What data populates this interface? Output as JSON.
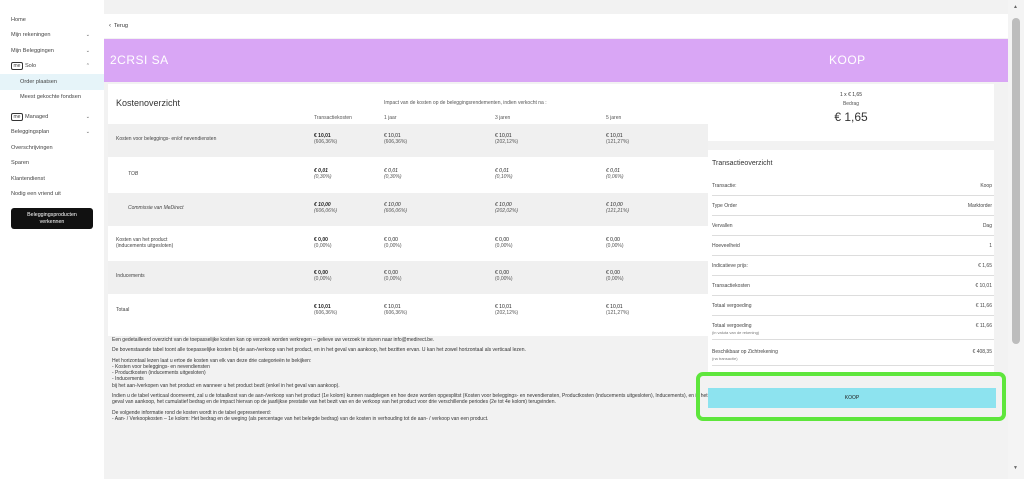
{
  "sidebar": {
    "items": [
      {
        "label": "Home",
        "chevron": ""
      },
      {
        "label": "Mijn rekeningen",
        "chevron": "⌄"
      },
      {
        "label": "Mijn Beleggingen",
        "chevron": "⌄"
      },
      {
        "tag": "me",
        "label": "Solo",
        "chevron": "⌃"
      },
      {
        "label": "Order plaatsen",
        "sub": true,
        "active": true
      },
      {
        "label": "Meest gekochte fondsen",
        "sub": true
      },
      {
        "tag": "me",
        "label": "Managed",
        "chevron": "⌄"
      },
      {
        "label": "Beleggingsplan",
        "chevron": "⌄"
      },
      {
        "label": "Overschrijvingen",
        "chevron": ""
      },
      {
        "label": "Sparen",
        "chevron": ""
      },
      {
        "label": "Klantendienst",
        "chevron": ""
      },
      {
        "label": "Nodig een vriend uit",
        "chevron": ""
      }
    ],
    "cta_line1": "Beleggingsproducten",
    "cta_line2": "verkennen"
  },
  "back_label": "Terug",
  "header": {
    "product_name": "2CRSI SA",
    "action_title": "KOOP",
    "band_color": "#d9a6f5"
  },
  "cost_overview": {
    "title": "Kostenoverzicht",
    "impact_note": "Impact van de kosten op de beleggingsrendementen, indien verkocht na :",
    "columns": [
      "Transactiekosten",
      "1 jaar",
      "3 jaren",
      "5 jaren"
    ],
    "rows": [
      {
        "label": "Kosten voor beleggings- en/of nevendiensten",
        "italic": false,
        "shade": true,
        "cells": [
          [
            "€ 10,01",
            "(606,36%)"
          ],
          [
            "€ 10,01",
            "(606,36%)"
          ],
          [
            "€ 10,01",
            "(202,12%)"
          ],
          [
            "€ 10,01",
            "(121,27%)"
          ]
        ]
      },
      {
        "label": "TOB",
        "italic": true,
        "shade": false,
        "cells": [
          [
            "€ 0,01",
            "(0,30%)"
          ],
          [
            "€ 0,01",
            "(0,30%)"
          ],
          [
            "€ 0,01",
            "(0,10%)"
          ],
          [
            "€ 0,01",
            "(0,06%)"
          ]
        ]
      },
      {
        "label": "Commissie van MeDirect",
        "italic": true,
        "shade": true,
        "cells": [
          [
            "€ 10,00",
            "(606,06%)"
          ],
          [
            "€ 10,00",
            "(606,06%)"
          ],
          [
            "€ 10,00",
            "(202,02%)"
          ],
          [
            "€ 10,00",
            "(121,21%)"
          ]
        ]
      },
      {
        "label": "Kosten van het product",
        "label2": "(inducements uitgesloten)",
        "italic": false,
        "shade": false,
        "cells": [
          [
            "€ 0,00",
            "(0,00%)"
          ],
          [
            "€ 0,00",
            "(0,00%)"
          ],
          [
            "€ 0,00",
            "(0,00%)"
          ],
          [
            "€ 0,00",
            "(0,00%)"
          ]
        ]
      },
      {
        "label": "Inducements",
        "italic": false,
        "shade": true,
        "cells": [
          [
            "€ 0,00",
            "(0,00%)"
          ],
          [
            "€ 0,00",
            "(0,00%)"
          ],
          [
            "€ 0,00",
            "(0,00%)"
          ],
          [
            "€ 0,00",
            "(0,00%)"
          ]
        ]
      },
      {
        "label": "Totaal",
        "italic": false,
        "shade": false,
        "cells": [
          [
            "€ 10,01",
            "(606,36%)"
          ],
          [
            "€ 10,01",
            "(606,36%)"
          ],
          [
            "€ 10,01",
            "(202,12%)"
          ],
          [
            "€ 10,01",
            "(121,27%)"
          ]
        ]
      }
    ]
  },
  "info_text": {
    "p1": "Een gedetailleerd overzicht van de toepasselijke kosten kan op verzoek worden verkregen – gelieve uw verzoek te sturen naar info@medirect.be.",
    "p2": "De bovenstaande tabel toont alle toepasselijke kosten bij de aan-/verkoop van het product, en in het geval van aankoop, het bezitten ervan. U kan het zowel horizontaal als verticaal lezen.",
    "p3_lines": [
      "Het horizontaal lezen laat u ertoe de kosten van elk van deze drie categorieën te bekijken:",
      "- Kosten voor beleggings- en nevendiensten",
      "- Productkosten (inducements uitgesloten)",
      "- Inducements",
      "bij het aan-/verkopen van het product en wanneer u het product bezit (enkel in het geval van aankoop)."
    ],
    "p4": "Indien u de tabel verticaal doorneemt, zal u de totaalkost van de aan-/verkoop van het product (1e kolom) kunnen raadplegen en hoe deze worden opgesplitst (Kosten voor beleggings- en nevendiensten, Productkosten (inducements uitgesloten), Inducements), en in het geval van aankoop, het cumulatief bedrag en de impact hiervan op de jaarlijkse prestatie van het bezit van en de verkoop van het product voor drie verschillende periodes (2e tot 4e kolom) terugvinden.",
    "p5_lines": [
      "De volgende informatie rond de kosten wordt in de tabel gepresenteerd:",
      "- Aan- / Verkoopkosten – 1e kolom: Het bedrag en de weging (als percentage van het belegde bedrag) van de kosten in verhouding tot de aan- / verkoop van een product."
    ]
  },
  "summary": {
    "quantity_line": "1 x € 1,65",
    "amount_label": "Bedrag",
    "amount": "€ 1,65"
  },
  "transaction": {
    "title": "Transactieoverzicht",
    "rows": [
      {
        "key": "Transactie:",
        "value": "Koop"
      },
      {
        "key": "Type Order",
        "value": "Marktorder"
      },
      {
        "key": "Vervallen",
        "value": "Dag"
      },
      {
        "key": "Hoeveelheid",
        "value": "1"
      },
      {
        "key": "Indicatieve prijs:",
        "value": "€ 1,65"
      },
      {
        "key": "Transactiekosten",
        "value": "€ 10,01"
      },
      {
        "key": "Totaal vergoeding",
        "value": "€ 11,66"
      },
      {
        "key": "Totaal vergoeding",
        "sub": "(in valuta van de rekening)",
        "value": "€ 11,66"
      },
      {
        "key": "Beschikbaar op Zichtrekening",
        "sub": "(na transactie)",
        "value": "€ 408,35"
      }
    ]
  },
  "koop_button_label": "KOOP",
  "colors": {
    "accent_button": "#8de3ef",
    "highlight": "#5ee63c"
  }
}
